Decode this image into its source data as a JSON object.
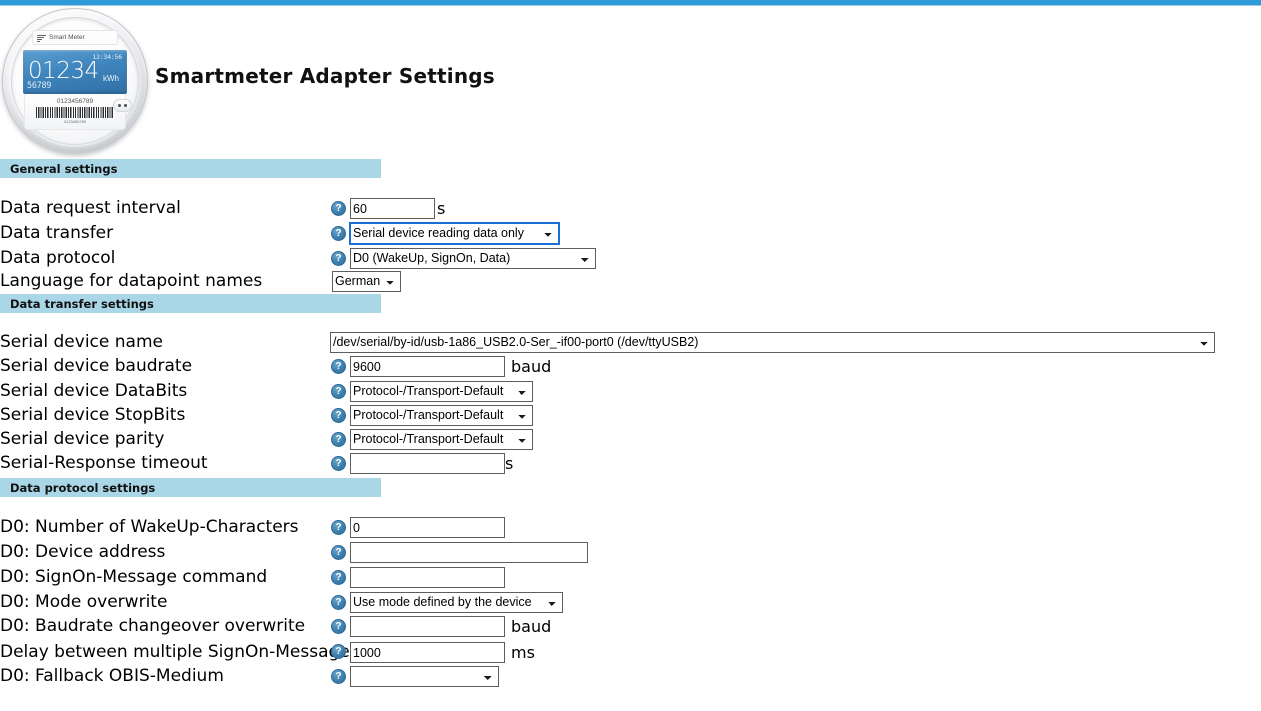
{
  "page": {
    "title": "Smartmeter Adapter Settings",
    "accent_color": "#2e9bd6",
    "section_bar_color": "#a9d7e8",
    "help_icon_color": "#3d7fae"
  },
  "meter": {
    "brand_label": "Smart Meter",
    "lcd_time": "12:34:56",
    "lcd_value": "01234",
    "lcd_unit": "kWh",
    "lcd_sub": "56789",
    "serial_number": "0123456789",
    "barcode_caption": "0123456789"
  },
  "sections": [
    {
      "id": "general",
      "title": "General settings"
    },
    {
      "id": "transfer",
      "title": "Data transfer settings"
    },
    {
      "id": "protocol",
      "title": "Data protocol settings"
    }
  ],
  "general": {
    "data_request_interval": {
      "label": "Data request interval",
      "help": "?",
      "value": "60",
      "unit": "s"
    },
    "data_transfer": {
      "label": "Data transfer",
      "help": "?",
      "value": "Serial device reading data only"
    },
    "data_protocol": {
      "label": "Data protocol",
      "help": "?",
      "value": "D0 (WakeUp, SignOn, Data)"
    },
    "language": {
      "label": "Language for datapoint names",
      "value": "German"
    }
  },
  "transfer": {
    "device_name": {
      "label": "Serial device name",
      "value": "/dev/serial/by-id/usb-1a86_USB2.0-Ser_-if00-port0 (/dev/ttyUSB2)"
    },
    "baudrate": {
      "label": "Serial device baudrate",
      "help": "?",
      "value": "9600",
      "unit": "baud"
    },
    "databits": {
      "label": "Serial device DataBits",
      "help": "?",
      "value": "Protocol-/Transport-Default"
    },
    "stopbits": {
      "label": "Serial device StopBits",
      "help": "?",
      "value": "Protocol-/Transport-Default"
    },
    "parity": {
      "label": "Serial device parity",
      "help": "?",
      "value": "Protocol-/Transport-Default"
    },
    "response_timeout": {
      "label": "Serial-Response timeout",
      "help": "?",
      "value": "",
      "unit": "s"
    }
  },
  "protocol": {
    "wakeup_chars": {
      "label": "D0: Number of WakeUp-Characters",
      "help": "?",
      "value": "0"
    },
    "device_address": {
      "label": "D0: Device address",
      "help": "?",
      "value": ""
    },
    "signon_command": {
      "label": "D0: SignOn-Message command",
      "help": "?",
      "value": ""
    },
    "mode_overwrite": {
      "label": "D0: Mode overwrite",
      "help": "?",
      "value": "Use mode defined by the device"
    },
    "baudrate_changeover": {
      "label": "D0: Baudrate changeover overwrite",
      "help": "?",
      "value": "",
      "unit": "baud"
    },
    "signon_delay": {
      "label": "Delay between multiple SignOn-Messages",
      "help": "?",
      "value": "1000",
      "unit": "ms"
    },
    "fallback_obis": {
      "label": "D0: Fallback OBIS-Medium",
      "help": "?",
      "value": ""
    }
  }
}
